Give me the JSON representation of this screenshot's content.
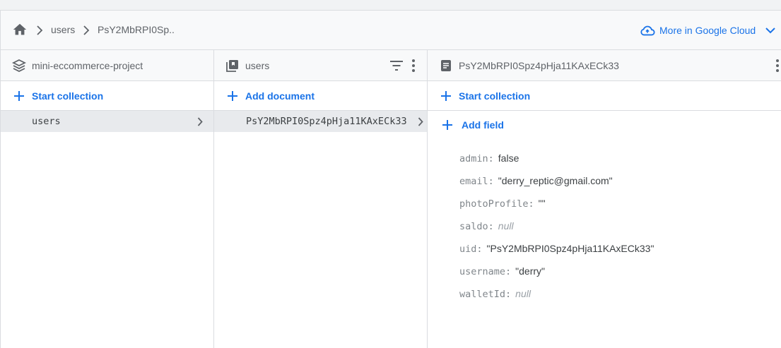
{
  "breadcrumb": {
    "items": [
      "users",
      "PsY2MbRPI0Sp.."
    ],
    "more_label": "More in Google Cloud"
  },
  "columns": {
    "project": {
      "title": "mini-eccommerce-project",
      "action_label": "Start collection",
      "items": [
        {
          "label": "users",
          "selected": true
        }
      ]
    },
    "collection": {
      "title": "users",
      "action_label": "Add document",
      "items": [
        {
          "label": "PsY2MbRPI0Spz4pHja11KAxECk33",
          "selected": true
        }
      ]
    },
    "document": {
      "title": "PsY2MbRPI0Spz4pHja11KAxECk33",
      "action_label": "Start collection",
      "add_field_label": "Add field",
      "fields": [
        {
          "key": "admin:",
          "value": "false",
          "is_null": false
        },
        {
          "key": "email:",
          "value": "\"derry_reptic@gmail.com\"",
          "is_null": false
        },
        {
          "key": "photoProfile:",
          "value": "\"\"",
          "is_null": false
        },
        {
          "key": "saldo:",
          "value": "null",
          "is_null": true
        },
        {
          "key": "uid:",
          "value": "\"PsY2MbRPI0Spz4pHja11KAxECk33\"",
          "is_null": false
        },
        {
          "key": "username:",
          "value": "\"derry\"",
          "is_null": false
        },
        {
          "key": "walletId:",
          "value": "null",
          "is_null": true
        }
      ]
    }
  },
  "icons": {
    "home": "home-icon",
    "breadcrumb_separator": "chevron-right-icon",
    "cloud": "cloud-icon",
    "expand": "chevron-down-icon",
    "project": "database-stack-icon",
    "collection": "collection-icon",
    "document": "document-icon",
    "filter": "filter-icon",
    "menu": "more-vert-icon",
    "add": "plus-icon"
  },
  "colors": {
    "accent": "#1a73e8",
    "header_bg": "#f8f9fa",
    "selected_row": "#e8eaed",
    "border": "#dadce0"
  }
}
